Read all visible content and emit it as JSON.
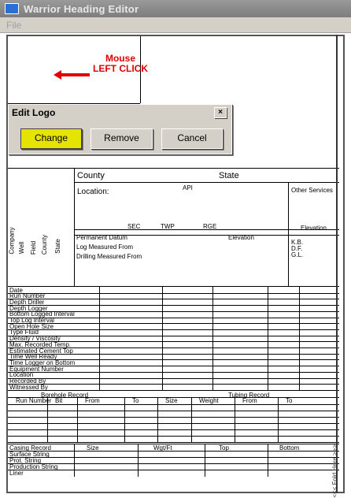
{
  "window": {
    "title": "Warrior Heading Editor"
  },
  "menu": {
    "file": "File"
  },
  "annotation": {
    "line1": "Mouse",
    "line2": "LEFT CLICK"
  },
  "dialog": {
    "title": "Edit Logo",
    "close": "×",
    "change": "Change",
    "remove": "Remove",
    "cancel": "Cancel"
  },
  "header": {
    "county": "County",
    "state": "State",
    "location": "Location:",
    "api": "API",
    "other_services": "Other Services",
    "sec": "SEC",
    "twp": "TWP",
    "rge": "RGE",
    "elevation_head": "Elevation",
    "perm_datum": "Permanent Datum",
    "elevation": "Elevation",
    "log_measured": "Log Measured From",
    "drilling_measured": "Drilling Measured From",
    "kb": "K.B.",
    "df": "D.F.",
    "gl": "G.L.",
    "vertical_labels": [
      "Company",
      "Well",
      "Field",
      "County",
      "State"
    ]
  },
  "run_rows": [
    "Date",
    "Run Number",
    "Depth Driller",
    "Depth Logger",
    "Bottom Logged Interval",
    "Top Log Interval",
    "Open Hole Size",
    "Type Fluid",
    "Density / Viscosity",
    "Max. Recorded Temp.",
    "Estimated Cement Top",
    "Time Well Ready",
    "Time Logger on Bottom",
    "Equipment Number",
    "Location",
    "Recorded By",
    "Witnessed By"
  ],
  "borehole": {
    "title": "Borehole Record",
    "tubing_title": "Tubing Record",
    "columns": [
      "Run Number",
      "Bit",
      "From",
      "To",
      "Size",
      "Weight",
      "From",
      "To"
    ]
  },
  "casing": {
    "columns": [
      "Casing Record",
      "Size",
      "Wgt/Ft",
      "Top",
      "Bottom"
    ],
    "rows": [
      "Surface String",
      "Prot. String",
      "Production String",
      "Liner"
    ]
  },
  "fold": {
    "text": "<<< Fold Here >>>"
  }
}
